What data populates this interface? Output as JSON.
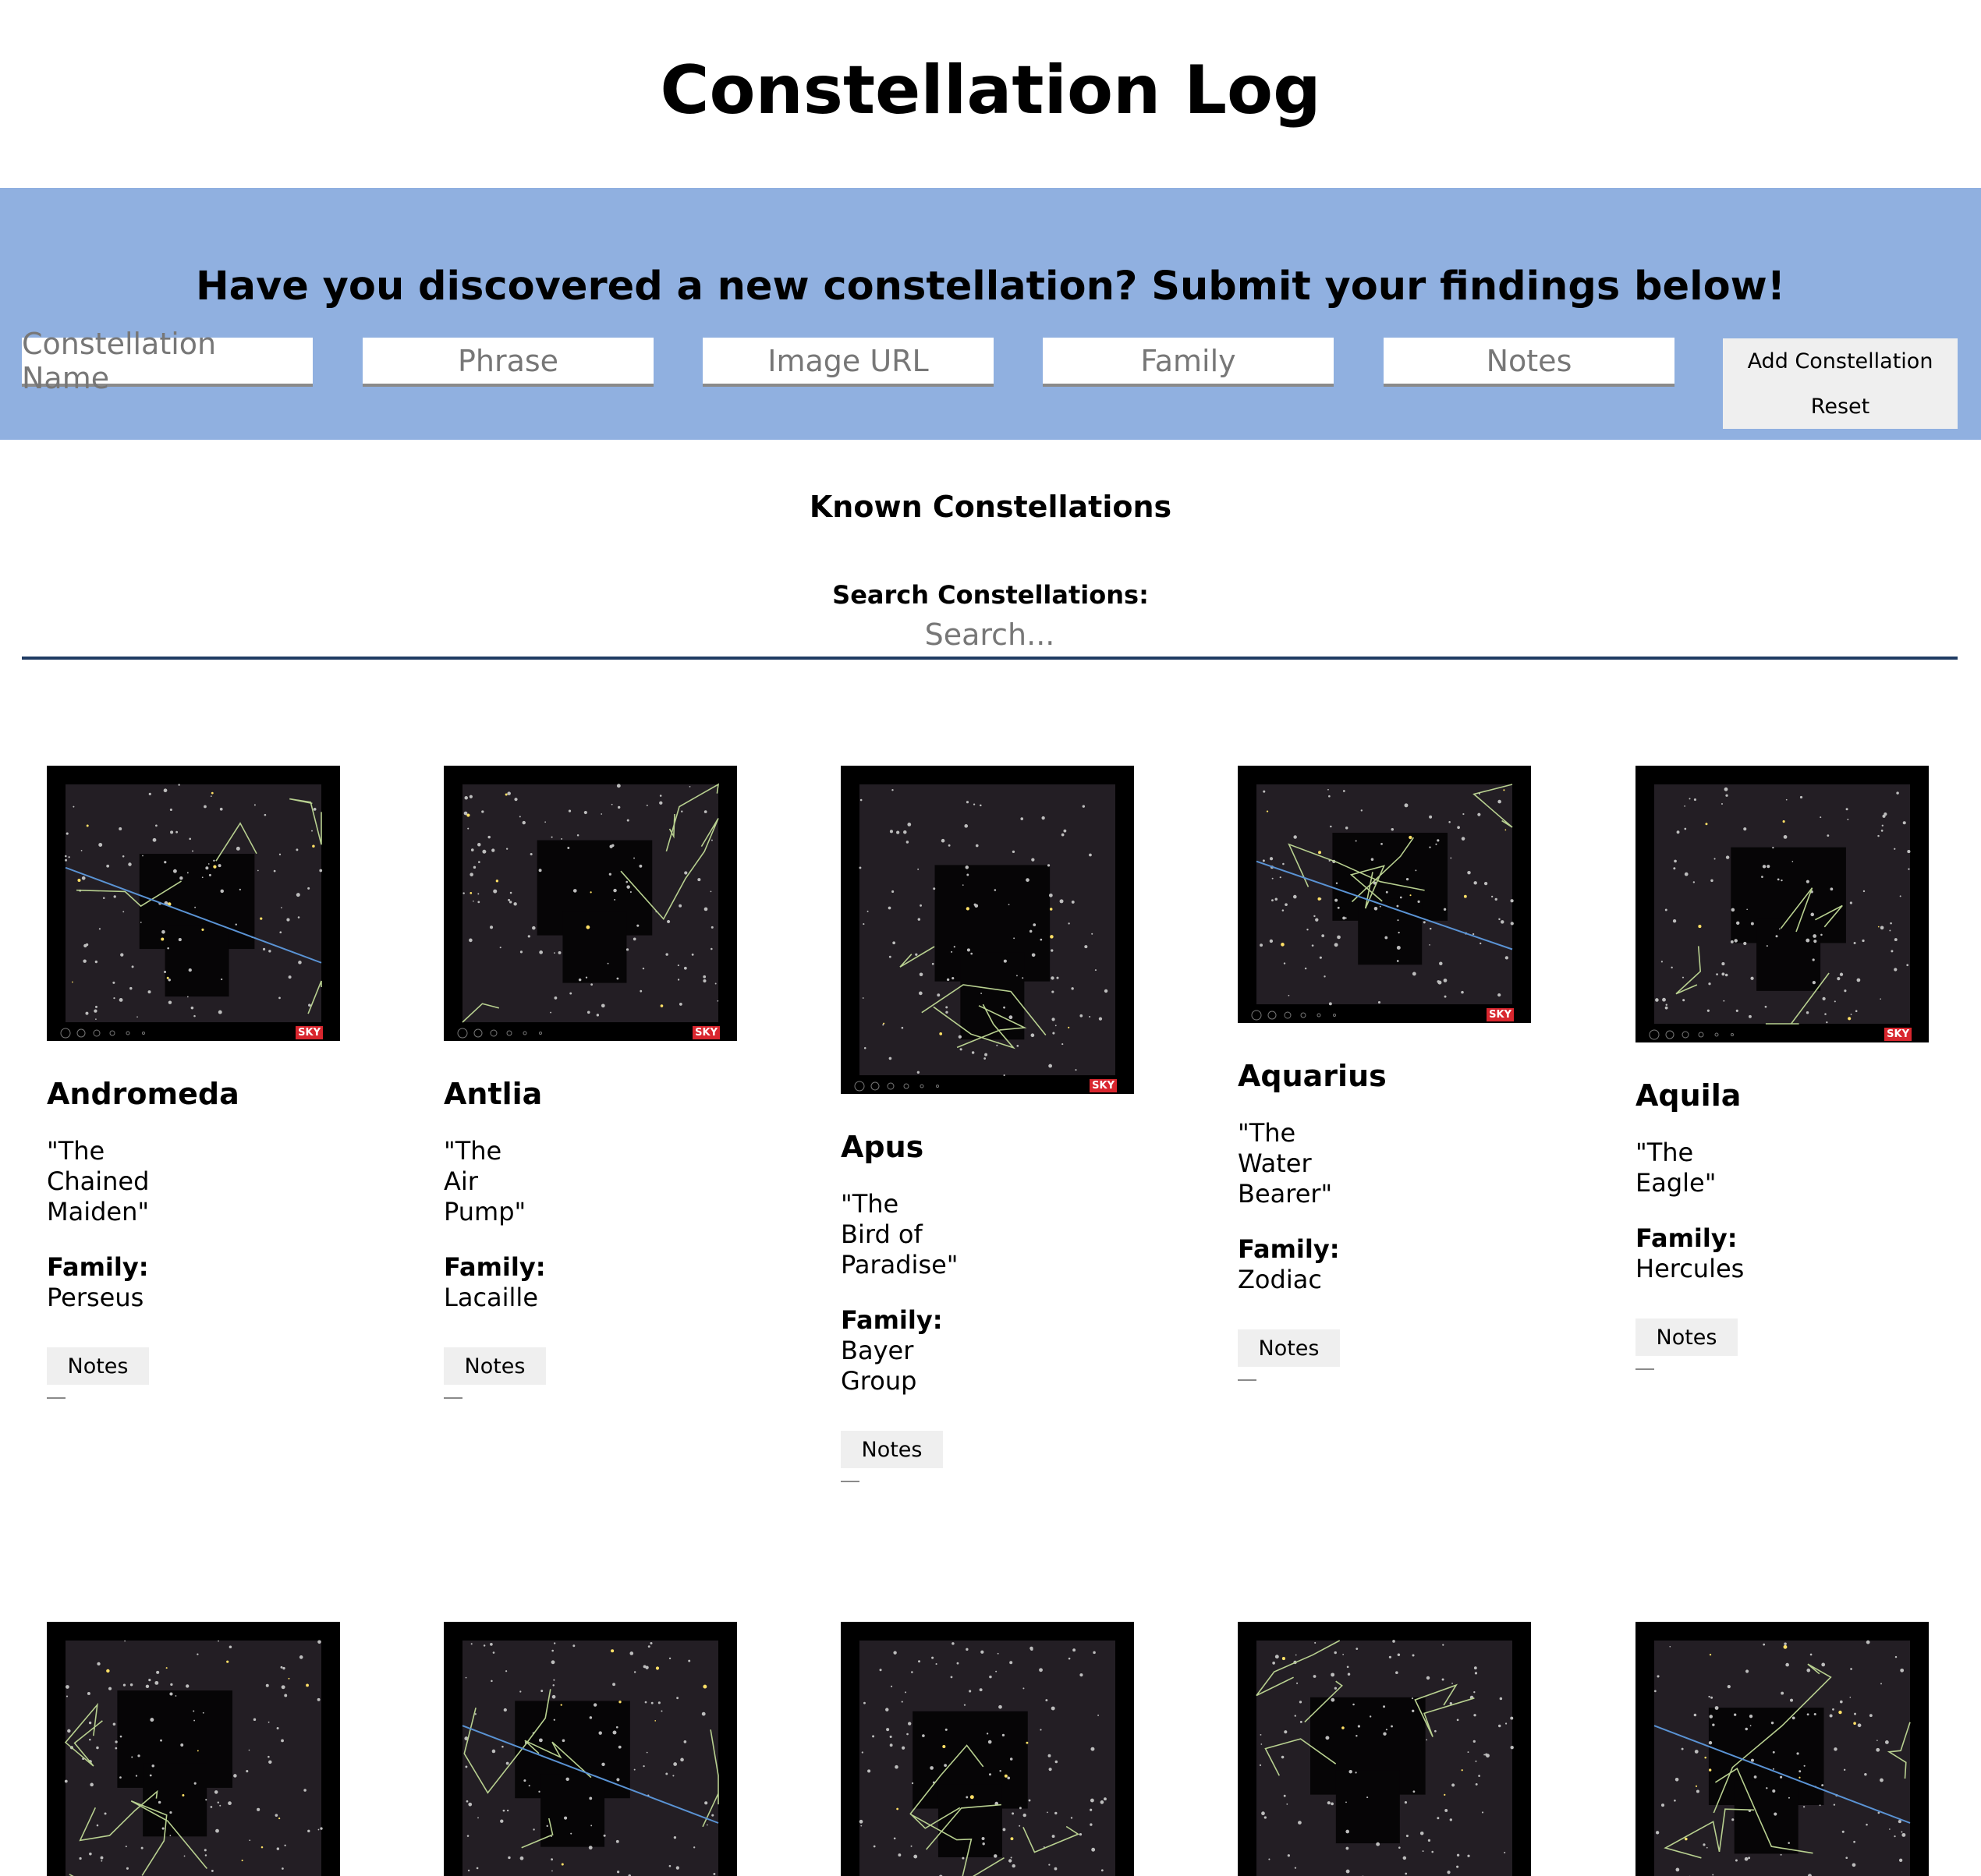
{
  "header": {
    "title": "Constellation Log"
  },
  "form": {
    "heading": "Have you discovered a new constellation? Submit your findings below!",
    "name_placeholder": "Constellation Name",
    "phrase_placeholder": "Phrase",
    "image_placeholder": "Image URL",
    "family_placeholder": "Family",
    "notes_placeholder": "Notes",
    "add_label": "Add Constellation",
    "reset_label": "Reset"
  },
  "list": {
    "title": "Known Constellations",
    "search_label": "Search Constellations:",
    "search_placeholder": "Search..."
  },
  "family_label": "Family:",
  "notes_label": "Notes",
  "sky_badge": "SKY",
  "constellations": [
    {
      "name": "Andromeda",
      "phrase": "\"The Chained Maiden\"",
      "family": "Perseus"
    },
    {
      "name": "Antlia",
      "phrase": "\"The Air Pump\"",
      "family": "Lacaille"
    },
    {
      "name": "Apus",
      "phrase": "\"The Bird of Paradise\"",
      "family": "Bayer Group"
    },
    {
      "name": "Aquarius",
      "phrase": "\"The Water Bearer\"",
      "family": "Zodiac"
    },
    {
      "name": "Aquila",
      "phrase": "\"The Eagle\"",
      "family": "Hercules"
    }
  ],
  "colors": {
    "form_band": "#90b0e0",
    "chart_bg": "#231e24",
    "constellation_line": "#b8d090",
    "ecliptic_line": "#5a93d4",
    "badge": "#d9262e"
  }
}
